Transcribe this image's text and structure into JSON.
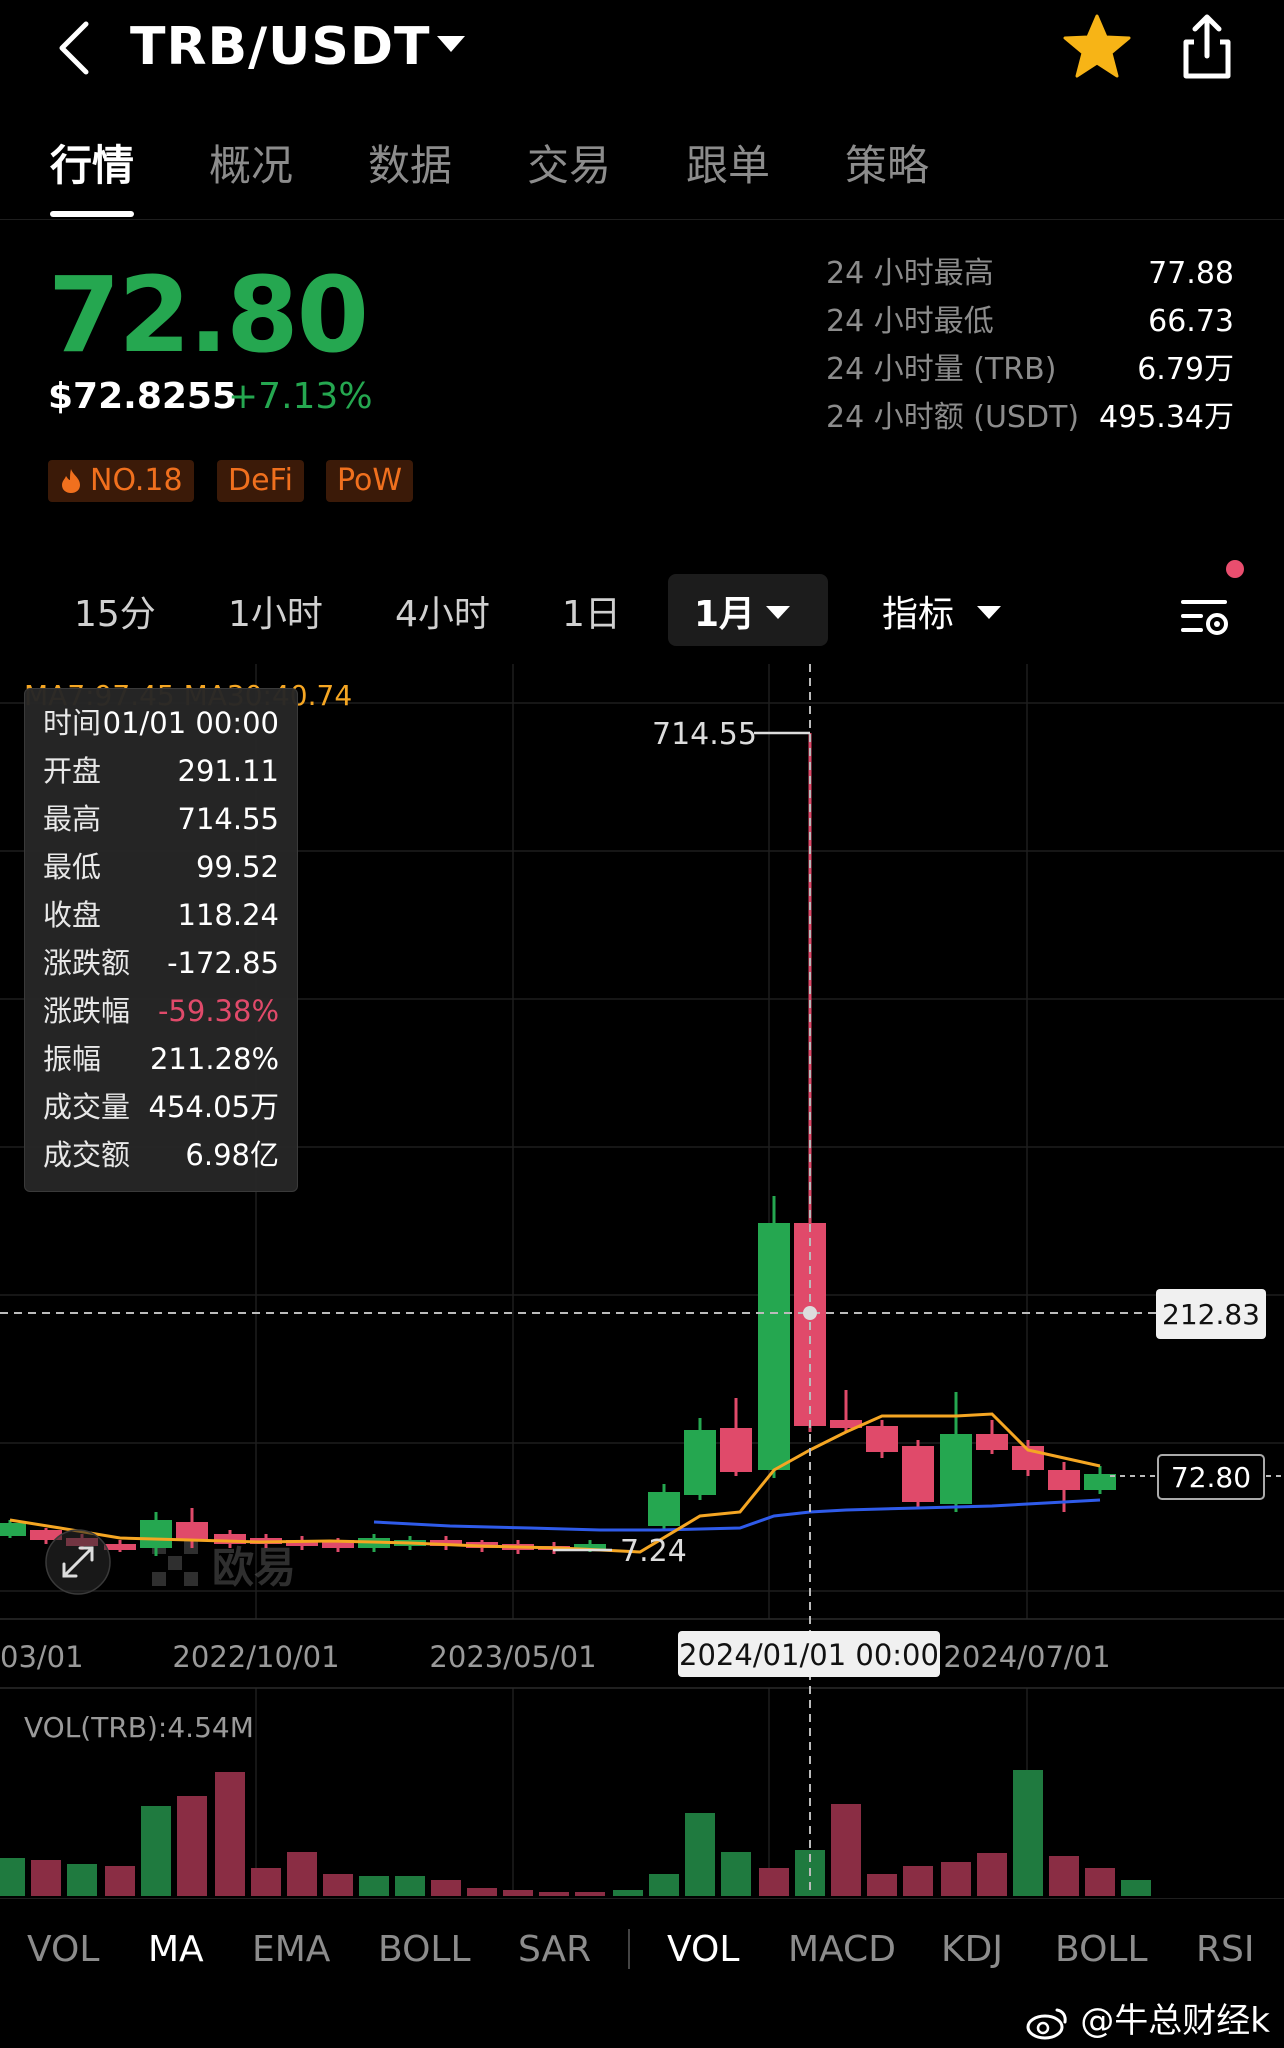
{
  "header": {
    "pair": "TRB/USDT"
  },
  "tabs": [
    "行情",
    "概况",
    "数据",
    "交易",
    "跟单",
    "策略"
  ],
  "price": {
    "last": "72.80",
    "usd": "$72.8255",
    "change_pct": "+7.13%"
  },
  "badges": [
    "NO.18",
    "DeFi",
    "PoW"
  ],
  "stats": [
    {
      "label": "24 小时最高",
      "value": "77.88"
    },
    {
      "label": "24 小时最低",
      "value": "66.73"
    },
    {
      "label": "24 小时量 (TRB)",
      "value": "6.79万"
    },
    {
      "label": "24 小时额 (USDT)",
      "value": "495.34万"
    }
  ],
  "intervals": [
    "15分",
    "1小时",
    "4小时",
    "1日"
  ],
  "interval_active": "1月",
  "indicator_menu": "指标",
  "chart": {
    "ma_legend": "MA7:97.45  MA30:40.74",
    "high_label": "714.55",
    "low_label": "7.24",
    "crosshair_price": "212.83",
    "last_price_tag": "72.80",
    "x_labels": [
      "03/01",
      "2022/10/01",
      "2023/05/01",
      "2024/07/01"
    ],
    "crosshair_date": "2024/01/01 00:00",
    "vol_label": "VOL(TRB):4.54M",
    "logo_text": "欧易"
  },
  "tooltip": [
    {
      "label": "时间",
      "value": "01/01 00:00"
    },
    {
      "label": "开盘",
      "value": "291.11"
    },
    {
      "label": "最高",
      "value": "714.55"
    },
    {
      "label": "最低",
      "value": "99.52"
    },
    {
      "label": "收盘",
      "value": "118.24"
    },
    {
      "label": "涨跌额",
      "value": "-172.85"
    },
    {
      "label": "涨跌幅",
      "value": "-59.38%"
    },
    {
      "label": "振幅",
      "value": "211.28%"
    },
    {
      "label": "成交量",
      "value": "454.05万"
    },
    {
      "label": "成交额",
      "value": "6.98亿"
    }
  ],
  "indicators_main": [
    "VOL",
    "MA",
    "EMA",
    "BOLL",
    "SAR"
  ],
  "indicators_sub": [
    "VOL",
    "MACD",
    "KDJ",
    "BOLL",
    "RSI"
  ],
  "watermark": "@牛总财经k",
  "colors": {
    "up": "#25a750",
    "down": "#e04a6a",
    "ma7": "#f5a623",
    "ma30": "#2f5bea",
    "badge_text": "#f0701e",
    "star": "#f7b416"
  }
}
